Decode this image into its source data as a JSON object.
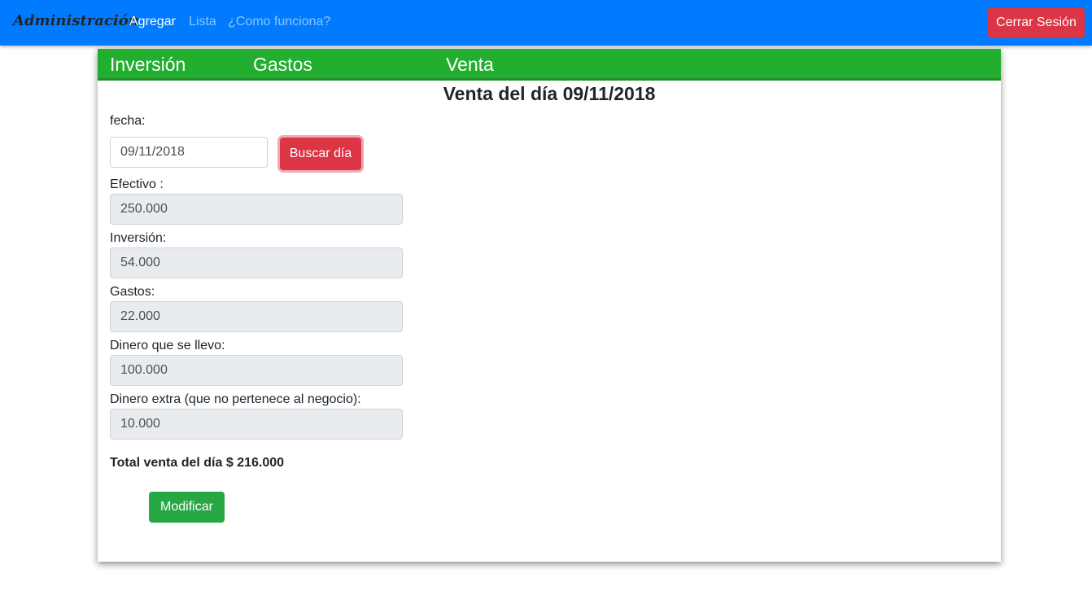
{
  "navbar": {
    "brand": "Administración",
    "links": [
      "Agregar",
      "Lista",
      "¿Como funciona?"
    ],
    "logout_label": "Cerrar Sesión"
  },
  "tabs": [
    "Inversión",
    "Gastos",
    "Venta"
  ],
  "page_title": "Venta del día 09/11/2018",
  "date": {
    "label": "fecha:",
    "value": "09/11/2018",
    "search_label": "Buscar día"
  },
  "fields": [
    {
      "label": "Efectivo :",
      "value": "250.000"
    },
    {
      "label": "Inversión:",
      "value": "54.000"
    },
    {
      "label": "Gastos:",
      "value": "22.000"
    },
    {
      "label": "Dinero que se llevo:",
      "value": "100.000"
    },
    {
      "label": "Dinero extra (que no pertenece al negocio):",
      "value": "10.000"
    }
  ],
  "total": "Total venta del día $ 216.000",
  "modify_label": "Modificar",
  "colors": {
    "navbar": "#007bff",
    "danger": "#dc3545",
    "success": "#28a745",
    "tabs": "#22ae2f"
  }
}
